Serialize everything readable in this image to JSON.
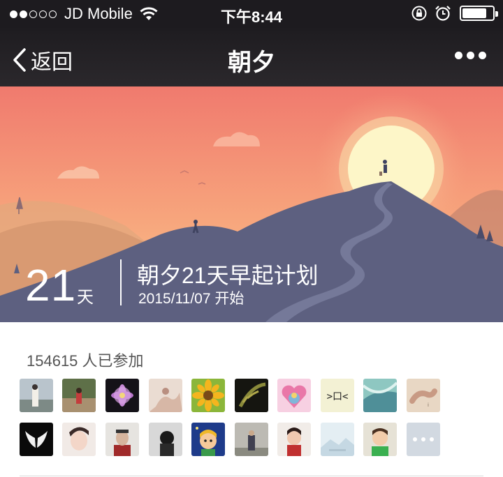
{
  "status_bar": {
    "carrier": "JD Mobile",
    "time": "下午8:44",
    "signal_bars_filled": 2,
    "signal_bars_total": 5,
    "battery_level": 0.8
  },
  "nav": {
    "back_label": "返回",
    "title": "朝夕"
  },
  "plan": {
    "days": "21",
    "days_unit": "天",
    "title": "朝夕21天早起计划",
    "start_date": "2015/11/07 开始"
  },
  "participants": {
    "count_text": "154615 人已参加"
  },
  "colors": {
    "status_bg": "#1d1b1f",
    "sky_top": "#f07a6e",
    "sky_bottom": "#f9c98e",
    "mountain": "#5d6080",
    "sun": "#fdf6c8"
  },
  "icons": {
    "back": "chevron-left-icon",
    "more": "more-dots-icon",
    "wifi": "wifi-icon",
    "rotation_lock": "rotation-lock-icon",
    "alarm": "alarm-icon",
    "battery": "battery-icon"
  }
}
